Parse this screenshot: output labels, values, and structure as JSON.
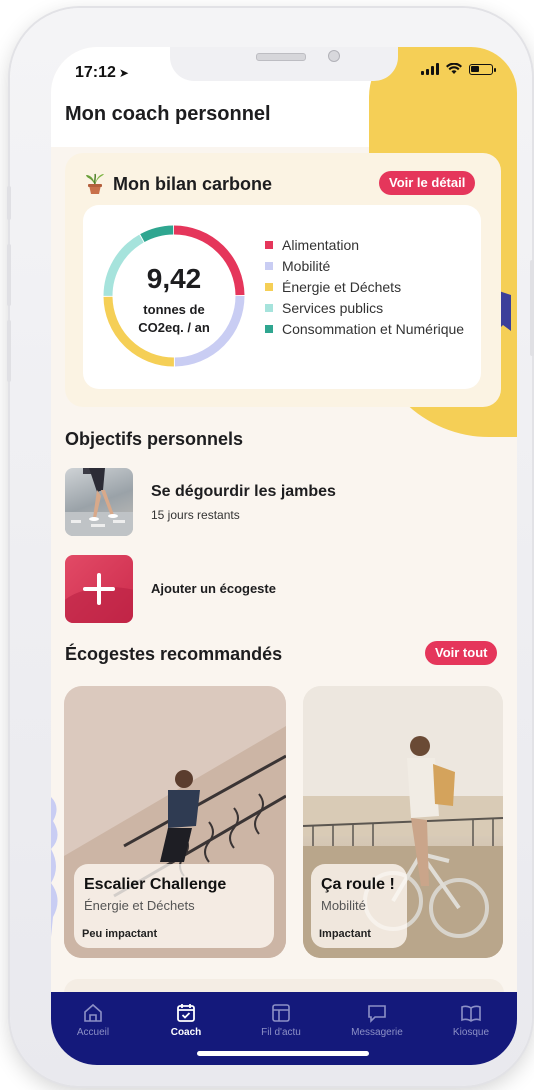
{
  "status": {
    "time": "17:12"
  },
  "page": {
    "title": "Mon coach personnel"
  },
  "carbon": {
    "title": "Mon bilan carbone",
    "detail_label": "Voir le détail",
    "value": "9,42",
    "unit_line1": "tonnes de",
    "unit_line2": "CO2eq. / an",
    "legend": [
      {
        "label": "Alimentation",
        "color": "#e5365b"
      },
      {
        "label": "Mobilité",
        "color": "#c9cdf3"
      },
      {
        "label": "Énergie et Déchets",
        "color": "#f5cf56"
      },
      {
        "label": "Services publics",
        "color": "#a6e3dc"
      },
      {
        "label": "Consommation et Numérique",
        "color": "#2fa690"
      }
    ]
  },
  "objectives": {
    "title": "Objectifs personnels",
    "goal": {
      "title": "Se dégourdir les jambes",
      "subtitle": "15 jours restants"
    },
    "add_label": "Ajouter un écogeste"
  },
  "recommended": {
    "title": "Écogestes recommandés",
    "see_all_label": "Voir tout",
    "cards": [
      {
        "title": "Escalier Challenge",
        "category": "Énergie et Déchets",
        "impact": "Peu impactant"
      },
      {
        "title": "Ça roule !",
        "category": "Mobilité",
        "impact": "Impactant"
      }
    ]
  },
  "tabs": [
    {
      "label": "Accueil",
      "icon": "home-icon",
      "active": false
    },
    {
      "label": "Coach",
      "icon": "calendar-check-icon",
      "active": true
    },
    {
      "label": "Fil d'actu",
      "icon": "layout-icon",
      "active": false
    },
    {
      "label": "Messagerie",
      "icon": "chat-icon",
      "active": false
    },
    {
      "label": "Kiosque",
      "icon": "book-icon",
      "active": false
    }
  ],
  "colors": {
    "accent": "#e5365b",
    "navy": "#14197b",
    "yellow": "#f5cf56"
  }
}
